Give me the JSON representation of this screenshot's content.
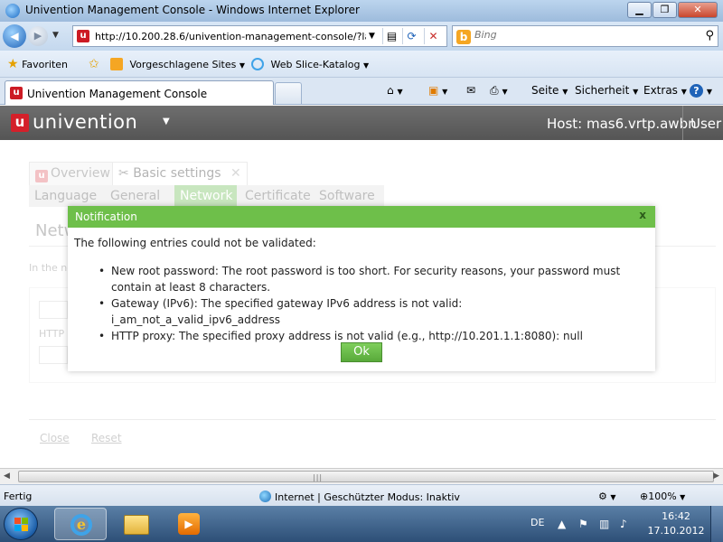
{
  "browser": {
    "window_title": "Univention Management Console - Windows Internet Explorer",
    "address_url": "http://10.200.28.6/univention-management-console/?la",
    "search_placeholder": "Bing",
    "favorites_label": "Favoriten",
    "fav_suggested": "Vorgeschlagene Sites",
    "fav_webslice": "Web Slice-Katalog",
    "tab_title": "Univention Management Console",
    "cmd_page": "Seite",
    "cmd_security": "Sicherheit",
    "cmd_extras": "Extras"
  },
  "umc": {
    "brand": "univention",
    "logo_letter": "u",
    "host": "Host: mas6.vrtp.awbn",
    "user": "User"
  },
  "module_tabs": {
    "overview": "Overview",
    "basic_settings": "Basic settings"
  },
  "subtabs": [
    "Language",
    "General",
    "Network",
    "Certificate",
    "Software"
  ],
  "background": {
    "section_title": "Netw",
    "hint": "In the ne",
    "field_label": "HTTP",
    "close_link": "Close",
    "reset_link": "Reset"
  },
  "dialog": {
    "title": "Notification",
    "close_glyph": "x",
    "intro": "The following entries could not be validated:",
    "items": [
      "New root password: The root password is too short. For security reasons, your password must contain at least 8 characters.",
      "Gateway (IPv6): The specified gateway IPv6 address is not valid: i_am_not_a_valid_ipv6_address",
      "HTTP proxy: The specified proxy address is not valid (e.g., http://10.201.1.1:8080): null"
    ],
    "ok_label": "Ok"
  },
  "statusbar": {
    "status": "Fertig",
    "zone": "Internet | Geschützter Modus: Inaktiv",
    "zoom": "100%"
  },
  "taskbar": {
    "language": "DE",
    "time": "16:42",
    "date": "17.10.2012"
  },
  "colors": {
    "accent_green": "#6ebf4a",
    "umc_red": "#d4202a",
    "header_gray": "#5f5f5f"
  }
}
